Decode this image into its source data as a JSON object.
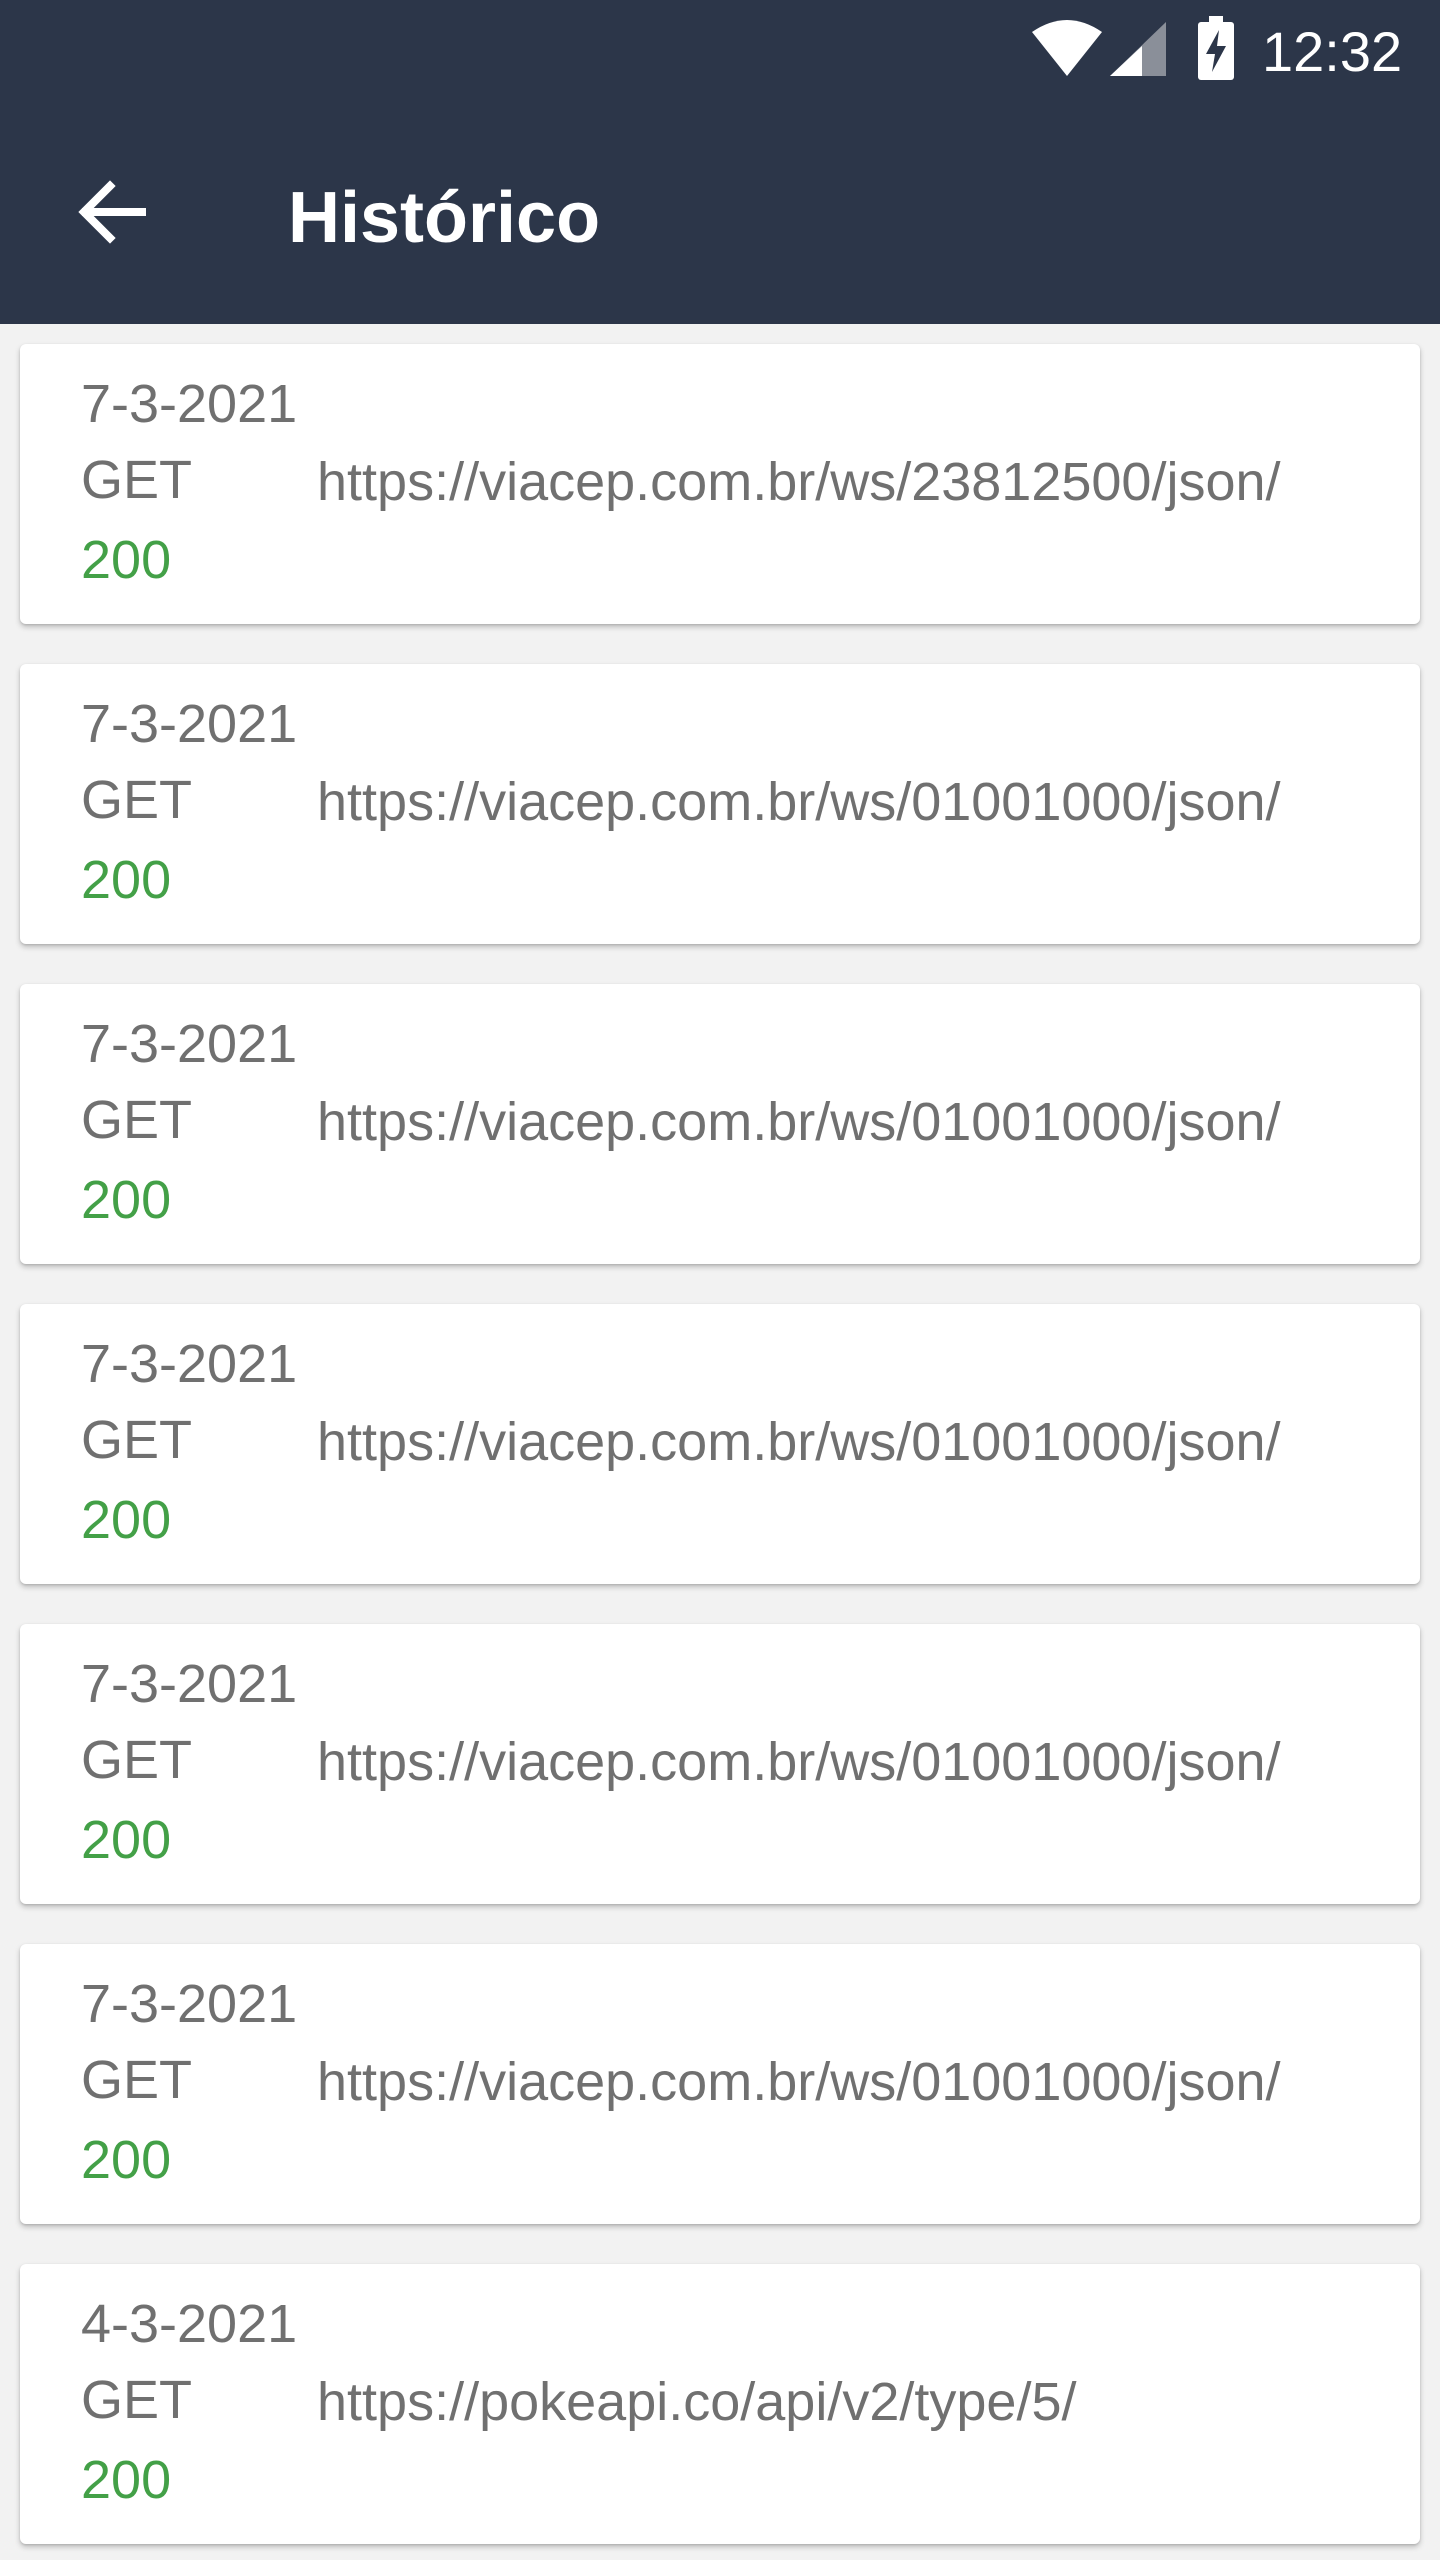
{
  "status_bar": {
    "time": "12:32",
    "icons": [
      "wifi-icon",
      "signal-icon",
      "battery-charging-icon"
    ]
  },
  "toolbar": {
    "back_icon": "arrow-left-icon",
    "title": "Histórico"
  },
  "colors": {
    "appbar": "#2c3649",
    "background": "#f2f2f2",
    "card": "#ffffff",
    "text": "#707070",
    "status_ok": "#43a047"
  },
  "history": [
    {
      "date": "7-3-2021",
      "method": "GET",
      "url": "https://viacep.com.br/ws/23812500/json/",
      "status": "200"
    },
    {
      "date": "7-3-2021",
      "method": "GET",
      "url": "https://viacep.com.br/ws/01001000/json/",
      "status": "200"
    },
    {
      "date": "7-3-2021",
      "method": "GET",
      "url": "https://viacep.com.br/ws/01001000/json/",
      "status": "200"
    },
    {
      "date": "7-3-2021",
      "method": "GET",
      "url": "https://viacep.com.br/ws/01001000/json/",
      "status": "200"
    },
    {
      "date": "7-3-2021",
      "method": "GET",
      "url": "https://viacep.com.br/ws/01001000/json/",
      "status": "200"
    },
    {
      "date": "7-3-2021",
      "method": "GET",
      "url": "https://viacep.com.br/ws/01001000/json/",
      "status": "200"
    },
    {
      "date": "4-3-2021",
      "method": "GET",
      "url": "https://pokeapi.co/api/v2/type/5/",
      "status": "200"
    }
  ]
}
